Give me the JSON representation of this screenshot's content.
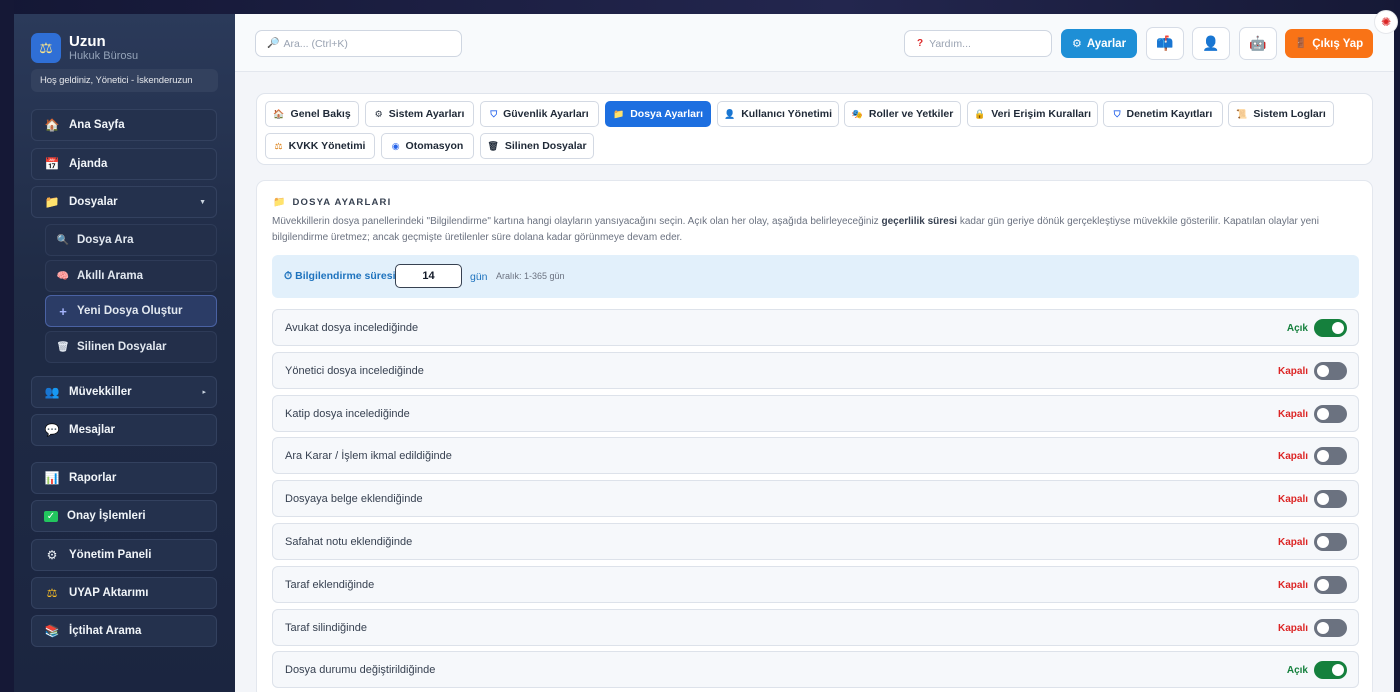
{
  "brand": {
    "name": "Uzun",
    "subtitle": "Hukuk Bürosu",
    "welcome": "Hoş geldiniz, Yönetici - İskenderuzun"
  },
  "sidebar": {
    "items": [
      {
        "label": "Ana Sayfa",
        "icon": "home-icon"
      },
      {
        "label": "Ajanda",
        "icon": "calendar-icon"
      },
      {
        "label": "Dosyalar",
        "icon": "folder-icon"
      },
      {
        "label": "Müvekkiller",
        "icon": "users-icon"
      },
      {
        "label": "Mesajlar",
        "icon": "chat-icon"
      },
      {
        "label": "Raporlar",
        "icon": "chart-icon"
      },
      {
        "label": "Onay İşlemleri",
        "icon": "check-icon"
      },
      {
        "label": "Yönetim Paneli",
        "icon": "gear-icon"
      },
      {
        "label": "UYAP Aktarımı",
        "icon": "scale-icon"
      },
      {
        "label": "İçtihat Arama",
        "icon": "books-icon"
      }
    ],
    "subitems": [
      {
        "label": "Dosya Ara",
        "icon": "search-icon"
      },
      {
        "label": "Akıllı Arama",
        "icon": "brain-icon"
      },
      {
        "label": "Yeni Dosya Oluştur",
        "icon": "plus-icon"
      },
      {
        "label": "Silinen Dosyalar",
        "icon": "trash-icon"
      }
    ]
  },
  "topbar": {
    "search_placeholder": "Ara... (Ctrl+K)",
    "help_placeholder": "Yardım...",
    "settings_label": "Ayarlar",
    "logout_label": "Çıkış Yap"
  },
  "tabs": [
    {
      "label": "Genel Bakış",
      "icon": "house-icon"
    },
    {
      "label": "Sistem Ayarları",
      "icon": "gear-icon"
    },
    {
      "label": "Güvenlik Ayarları",
      "icon": "shield-icon"
    },
    {
      "label": "Dosya Ayarları",
      "icon": "folder-icon"
    },
    {
      "label": "Kullanıcı Yönetimi",
      "icon": "user-icon"
    },
    {
      "label": "Roller ve Yetkiler",
      "icon": "roles-icon"
    },
    {
      "label": "Veri Erişim Kuralları",
      "icon": "lock-icon"
    },
    {
      "label": "Denetim Kayıtları",
      "icon": "shield-icon"
    },
    {
      "label": "Sistem Logları",
      "icon": "scroll-icon"
    },
    {
      "label": "KVKK Yönetimi",
      "icon": "scale-icon"
    },
    {
      "label": "Otomasyon",
      "icon": "bot-icon"
    },
    {
      "label": "Silinen Dosyalar",
      "icon": "trash-icon"
    }
  ],
  "card": {
    "title": "DOSYA AYARLARI",
    "desc_part1": "Müvekkillerin dosya panellerindeki \"Bilgilendirme\" kartına hangi olayların yansıyacağını seçin. Açık olan her olay, aşağıda belirleyeceğiniz ",
    "desc_bold": "geçerlilik süresi",
    "desc_part2": " kadar gün geriye dönük gerçekleştiyse müvekkile gösterilir. Kapatılan olaylar yeni bilgilendirme üretmez; ancak geçmişte üretilenler süre dolana kadar görünmeye devam eder.",
    "duration_label": "Bilgilendirme süresi:",
    "duration_value": "14",
    "duration_unit": "gün",
    "duration_range": "Aralık: 1-365 gün"
  },
  "events": [
    {
      "label": "Avukat dosya incelediğinde",
      "status": "Açık",
      "on": true
    },
    {
      "label": "Yönetici dosya incelediğinde",
      "status": "Kapalı",
      "on": false
    },
    {
      "label": "Katip dosya incelediğinde",
      "status": "Kapalı",
      "on": false
    },
    {
      "label": "Ara Karar / İşlem ikmal edildiğinde",
      "status": "Kapalı",
      "on": false
    },
    {
      "label": "Dosyaya belge eklendiğinde",
      "status": "Kapalı",
      "on": false
    },
    {
      "label": "Safahat notu eklendiğinde",
      "status": "Kapalı",
      "on": false
    },
    {
      "label": "Taraf eklendiğinde",
      "status": "Kapalı",
      "on": false
    },
    {
      "label": "Taraf silindiğinde",
      "status": "Kapalı",
      "on": false
    },
    {
      "label": "Dosya durumu değiştirildiğinde",
      "status": "Açık",
      "on": true
    }
  ],
  "colors": {
    "accent": "#1d6fe0",
    "settings": "#1e8fd6",
    "logout": "#f97316",
    "on": "#15803d",
    "off": "#dc2626"
  }
}
